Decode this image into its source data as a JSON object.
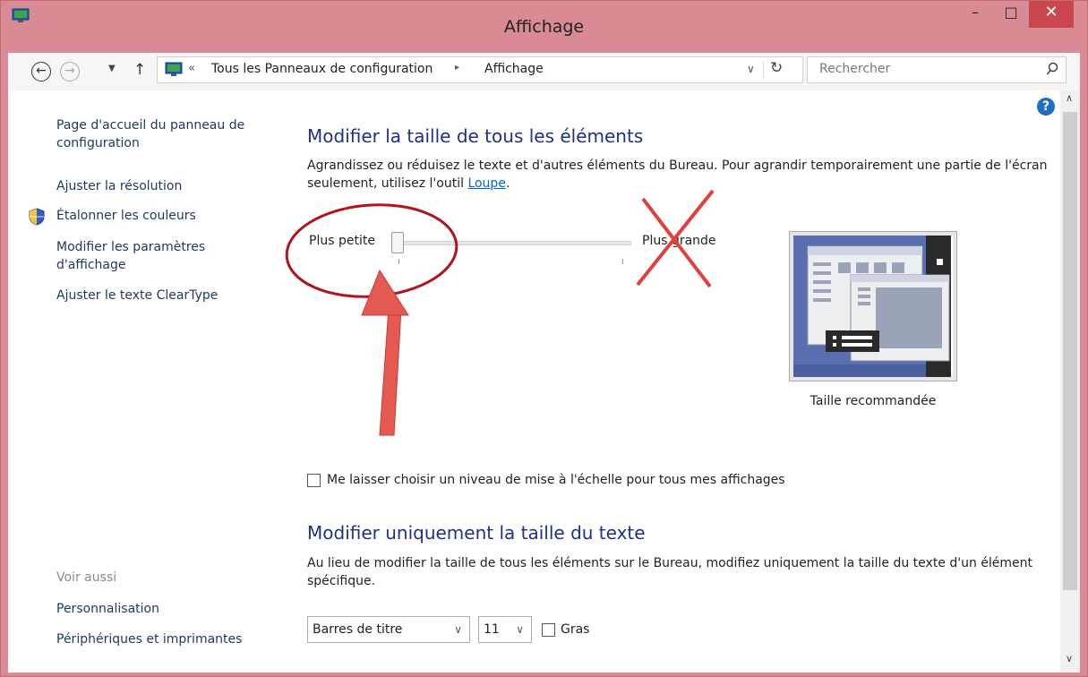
{
  "window": {
    "title": "Affichage",
    "minimize": "–",
    "maximize": "□",
    "close": "✕"
  },
  "nav": {
    "back": "←",
    "forward": "→",
    "recent": "▼",
    "up": "↑",
    "breadcrumb_chevron": "«",
    "breadcrumb_root": "Tous les Panneaux de configuration",
    "breadcrumb_sep": "▸",
    "breadcrumb_current": "Affichage",
    "dropdown": "∨",
    "refresh": "↻",
    "search_placeholder": "Rechercher"
  },
  "sidebar": {
    "home": "Page d'accueil du panneau de configuration",
    "items": [
      "Ajuster la résolution",
      "Étalonner les couleurs",
      "Modifier les paramètres d'affichage",
      "Ajuster le texte ClearType"
    ],
    "see_also": "Voir aussi",
    "see_also_items": [
      "Personnalisation",
      "Périphériques et imprimantes"
    ]
  },
  "main": {
    "section1_title": "Modifier la taille de tous les éléments",
    "section1_text": "Agrandissez ou réduisez le texte et d'autres éléments du Bureau. Pour agrandir temporairement une partie de l'écran seulement, utilisez l'outil",
    "loupe_link": "Loupe",
    "period": ".",
    "slider_min_label": "Plus petite",
    "slider_max_label": "Plus grande",
    "slider_value": 0,
    "preview_label": "Taille recommandée",
    "scaling_checkbox_label": "Me laisser choisir un niveau de mise à l'échelle pour tous mes affichages",
    "scaling_checkbox_checked": false,
    "section2_title": "Modifier uniquement la taille du texte",
    "section2_text": "Au lieu de modifier la taille de tous les éléments sur le Bureau, modifiez uniquement la taille du texte d'un élément spécifique.",
    "element_select": "Barres de titre",
    "size_select": "11",
    "bold_label": "Gras",
    "bold_checked": false
  },
  "help": "?",
  "colors": {
    "titlebar": "#d98a94",
    "heading": "#1e3287",
    "link": "#0066cc",
    "annotation_red": "#e0413a"
  }
}
